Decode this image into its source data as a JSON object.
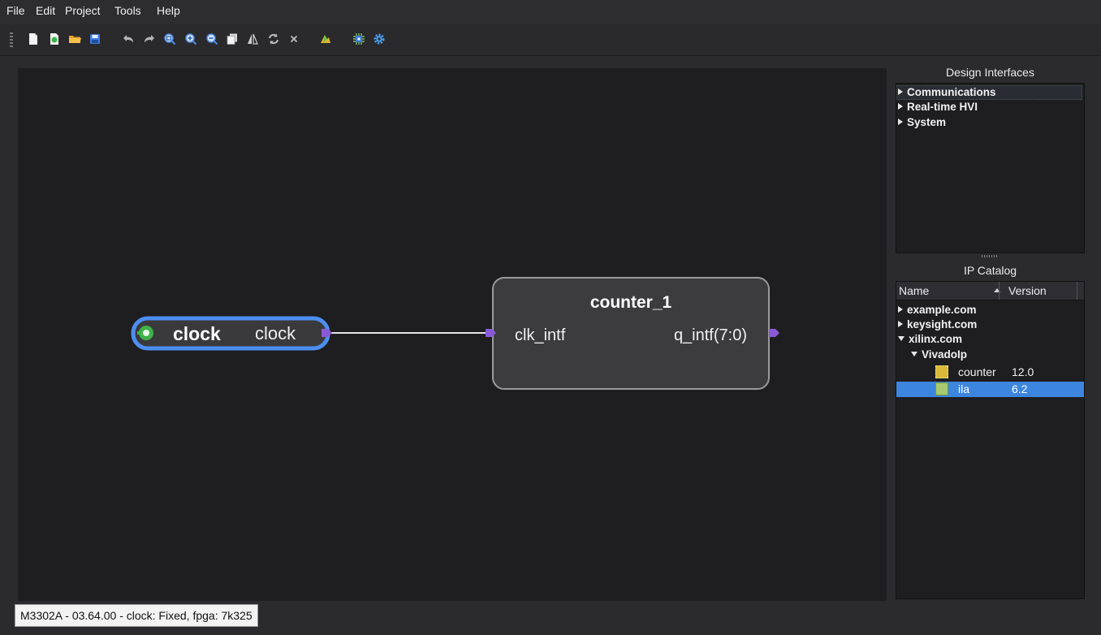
{
  "menu": [
    "File",
    "Edit",
    "Project",
    "Tools",
    "Help"
  ],
  "toolbar": {
    "buttons": [
      "new-file-icon",
      "new-project-icon",
      "open-folder-icon",
      "save-icon",
      "undo-icon",
      "redo-icon",
      "zoom-fit-icon",
      "zoom-in-icon",
      "zoom-out-icon",
      "copy-icon",
      "flip-icon",
      "refresh-icon",
      "delete-icon",
      "build-icon",
      "chip-icon",
      "settings-gear-icon"
    ]
  },
  "canvas": {
    "clock_block": {
      "name": "clock",
      "port": "clock"
    },
    "counter_block": {
      "title": "counter_1",
      "input_port": "clk_intf",
      "output_port": "q_intf(7:0)"
    },
    "colors": {
      "clock_border": "#4d8ef0",
      "clock_icon": "#3fb14a",
      "port": "#8a5ad6",
      "wire": "#e6e6e6",
      "block_fill": "#3c3c3f",
      "block_border": "#9a9a9a"
    }
  },
  "design_interfaces": {
    "title": "Design Interfaces",
    "items": [
      "Communications",
      "Real-time HVI",
      "System"
    ]
  },
  "ip_catalog": {
    "title": "IP Catalog",
    "columns": {
      "name": "Name",
      "version": "Version"
    },
    "items": [
      {
        "label": "example.com",
        "expanded": false
      },
      {
        "label": "keysight.com",
        "expanded": false
      },
      {
        "label": "xilinx.com",
        "expanded": true
      },
      {
        "label": "VivadoIp",
        "expanded": true
      }
    ],
    "ips": [
      {
        "name": "counter",
        "version": "12.0",
        "selected": false
      },
      {
        "name": "ila",
        "version": "6.2",
        "selected": true
      }
    ],
    "selection_color": "#3d86df"
  },
  "status": {
    "text": "M3302A - 03.64.00 - clock: Fixed, fpga: 7k325"
  }
}
